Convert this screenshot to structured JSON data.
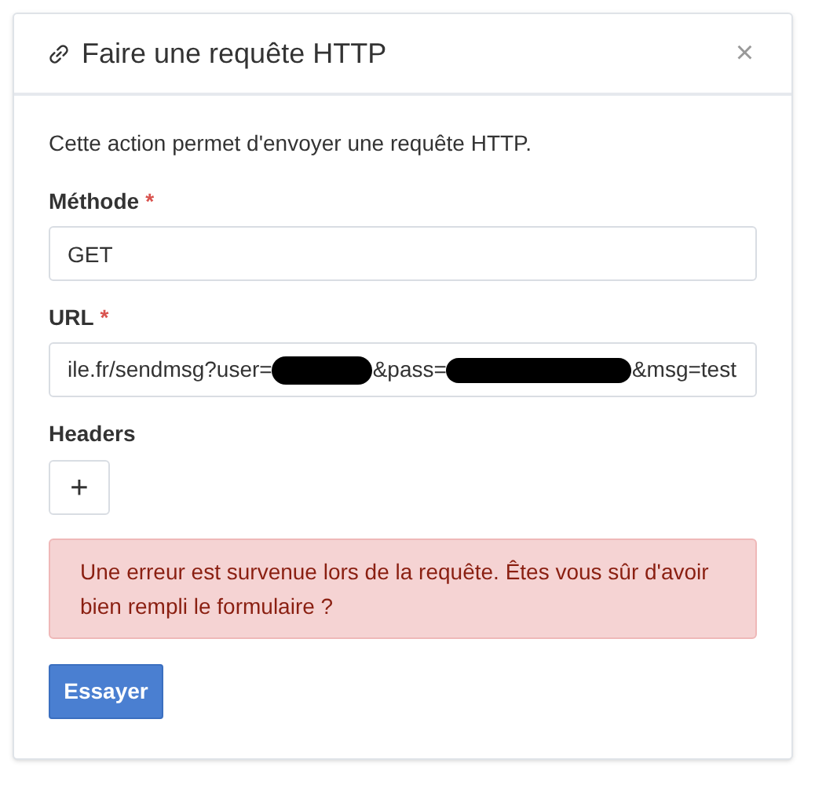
{
  "dialog": {
    "title": "Faire une requête HTTP",
    "close": "×"
  },
  "description": "Cette action permet d'envoyer une requête HTTP.",
  "fields": [
    {
      "label": "Méthode",
      "required_mark": "*",
      "kind": "text",
      "value": "GET"
    },
    {
      "label": "URL",
      "required_mark": "*",
      "kind": "segments",
      "segments": [
        {
          "kind": "text",
          "text": "ile.fr/sendmsg?user="
        },
        {
          "kind": "redaction"
        },
        {
          "kind": "text",
          "text": "&pass="
        },
        {
          "kind": "redaction"
        },
        {
          "kind": "text",
          "text": "&msg=test"
        }
      ]
    }
  ],
  "headers": {
    "label": "Headers",
    "add_button": "+"
  },
  "alert": {
    "kind": "error",
    "text": "Une erreur est survenue lors de la requête. Êtes vous sûr d'avoir bien rempli le formulaire ?"
  },
  "submit_button": "Essayer"
}
